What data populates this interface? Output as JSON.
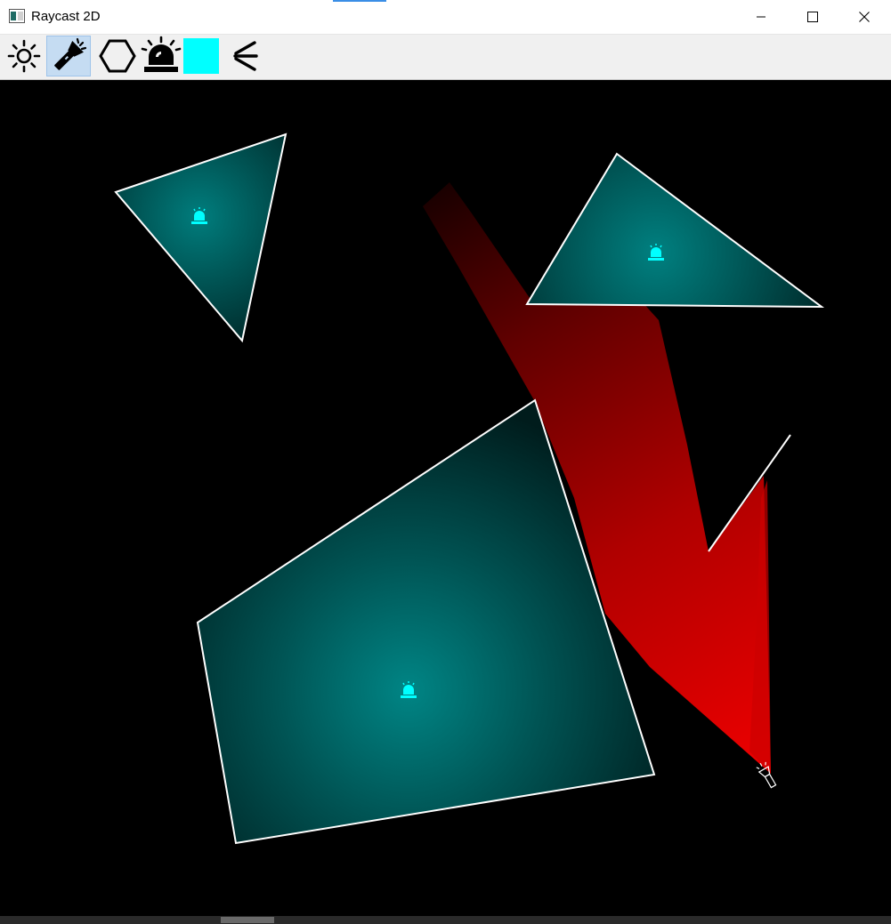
{
  "window": {
    "title": "Raycast 2D",
    "controls": [
      "minimize",
      "maximize",
      "close"
    ]
  },
  "toolbar": {
    "tools": [
      {
        "name": "point-light-tool",
        "icon": "sun-icon",
        "active": false
      },
      {
        "name": "flashlight-tool",
        "icon": "flashlight-icon",
        "active": true
      },
      {
        "name": "polygon-tool",
        "icon": "hexagon-icon",
        "active": false
      },
      {
        "name": "alarm-light-tool",
        "icon": "siren-icon",
        "active": false
      },
      {
        "name": "color-swatch",
        "icon": "color-swatch",
        "active": false,
        "color": "#00ffff"
      },
      {
        "name": "ray-spread-tool",
        "icon": "rays-icon",
        "active": false
      }
    ]
  },
  "scene": {
    "background": "#000000",
    "polygon_fill": "#008080",
    "polygon_stroke": "#ffffff",
    "light_color": "#00ffff",
    "beam_color": "#ff0000",
    "objects": [
      "triangle",
      "triangle",
      "quadrilateral",
      "flashlight",
      "wall-segment"
    ]
  }
}
